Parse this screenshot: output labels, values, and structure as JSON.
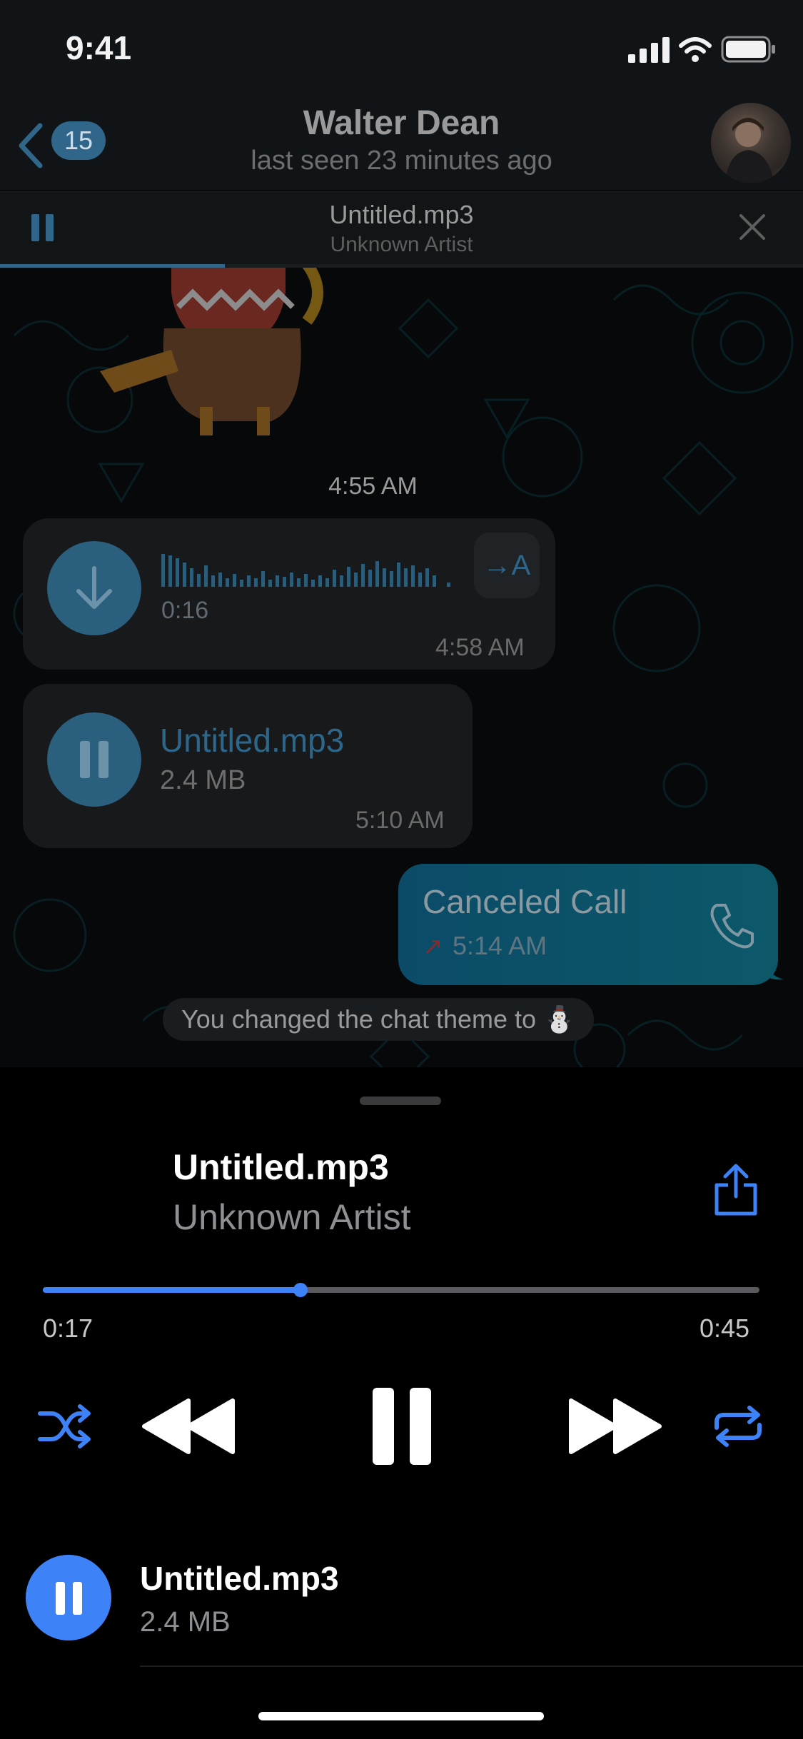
{
  "status_bar": {
    "time": "9:41"
  },
  "header": {
    "back_count": "15",
    "name": "Walter Dean",
    "status": "last seen 23 minutes ago"
  },
  "mini_player": {
    "title": "Untitled.mp3",
    "artist": "Unknown Artist",
    "progress": 0.28
  },
  "messages": {
    "time_separator": "4:55 AM",
    "voice": {
      "duration": "0:16",
      "time": "4:58 AM",
      "translate_label": "→A"
    },
    "audio": {
      "title": "Untitled.mp3",
      "size": "2.4 MB",
      "time": "5:10 AM"
    },
    "call": {
      "title": "Canceled Call",
      "arrow": "↗",
      "time": "5:14 AM"
    },
    "service": "You changed the chat theme to ⛄"
  },
  "player": {
    "title": "Untitled.mp3",
    "artist": "Unknown Artist",
    "elapsed": "0:17",
    "remaining": "0:45",
    "progress": 0.36,
    "accent": "#3e82f7"
  },
  "list_item": {
    "title": "Untitled.mp3",
    "size": "2.4 MB"
  }
}
